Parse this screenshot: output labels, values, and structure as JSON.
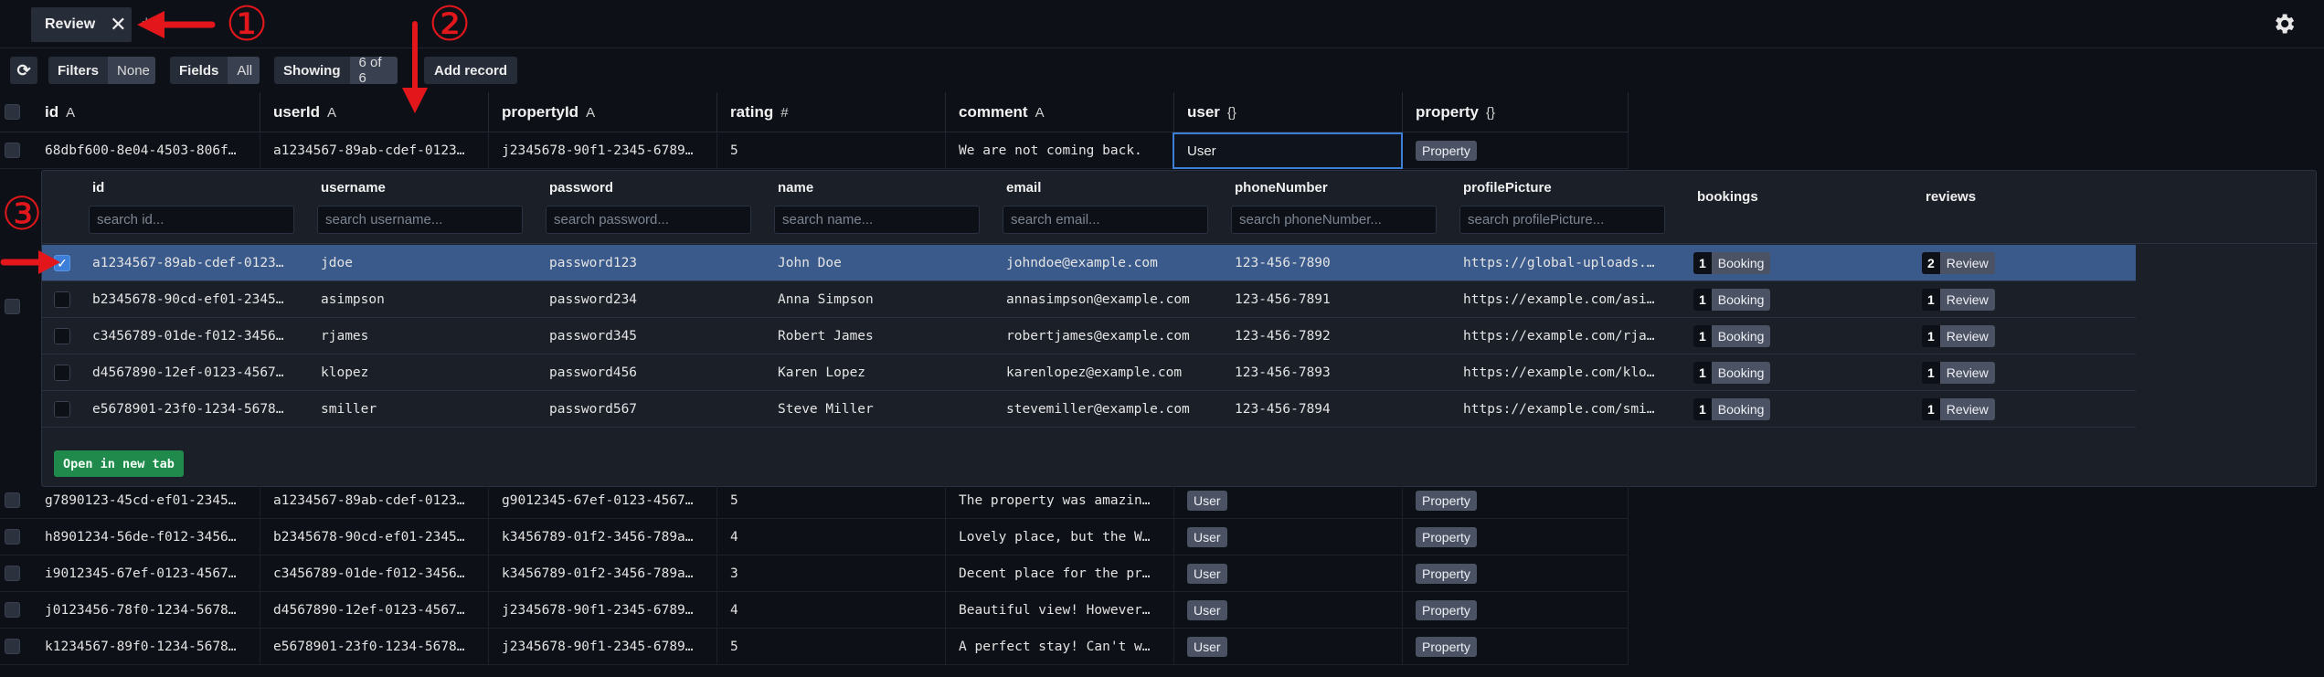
{
  "tab": {
    "label": "Review",
    "close": "✕",
    "plus": "+"
  },
  "toolbar": {
    "refresh": "⟳",
    "filters_label": "Filters",
    "filters_value": "None",
    "fields_label": "Fields",
    "fields_value": "All",
    "showing_label": "Showing",
    "showing_value": "6 of 6",
    "add_record": "Add record"
  },
  "columns": [
    {
      "name": "id",
      "type": "A"
    },
    {
      "name": "userId",
      "type": "A"
    },
    {
      "name": "propertyId",
      "type": "A"
    },
    {
      "name": "rating",
      "type": "#"
    },
    {
      "name": "comment",
      "type": "A"
    },
    {
      "name": "user",
      "type": "{}"
    },
    {
      "name": "property",
      "type": "{}"
    }
  ],
  "rows": [
    {
      "id": "68dbf600-8e04-4503-806f…",
      "userId": "a1234567-89ab-cdef-0123…",
      "propertyId": "j2345678-90f1-2345-6789…",
      "rating": "5",
      "comment": "We are not coming back.",
      "user": "User",
      "property": "Property"
    },
    {
      "id": "g7890123-45cd-ef01-2345…",
      "userId": "a1234567-89ab-cdef-0123…",
      "propertyId": "g9012345-67ef-0123-4567…",
      "rating": "5",
      "comment": "The property was amazin…",
      "user": "User",
      "property": "Property"
    },
    {
      "id": "h8901234-56de-f012-3456…",
      "userId": "b2345678-90cd-ef01-2345…",
      "propertyId": "k3456789-01f2-3456-789a…",
      "rating": "4",
      "comment": "Lovely place, but the W…",
      "user": "User",
      "property": "Property"
    },
    {
      "id": "i9012345-67ef-0123-4567…",
      "userId": "c3456789-01de-f012-3456…",
      "propertyId": "k3456789-01f2-3456-789a…",
      "rating": "3",
      "comment": "Decent place for the pr…",
      "user": "User",
      "property": "Property"
    },
    {
      "id": "j0123456-78f0-1234-5678…",
      "userId": "d4567890-12ef-0123-4567…",
      "propertyId": "j2345678-90f1-2345-6789…",
      "rating": "4",
      "comment": "Beautiful view! However…",
      "user": "User",
      "property": "Property"
    },
    {
      "id": "k1234567-89f0-1234-5678…",
      "userId": "e5678901-23f0-1234-5678…",
      "propertyId": "j2345678-90f1-2345-6789…",
      "rating": "5",
      "comment": "A perfect stay! Can't w…",
      "user": "User",
      "property": "Property"
    }
  ],
  "panel": {
    "columns": [
      {
        "name": "id",
        "placeholder": "search id..."
      },
      {
        "name": "username",
        "placeholder": "search username..."
      },
      {
        "name": "password",
        "placeholder": "search password..."
      },
      {
        "name": "name",
        "placeholder": "search name..."
      },
      {
        "name": "email",
        "placeholder": "search email..."
      },
      {
        "name": "phoneNumber",
        "placeholder": "search phoneNumber..."
      },
      {
        "name": "profilePicture",
        "placeholder": "search profilePicture..."
      },
      {
        "name": "bookings"
      },
      {
        "name": "reviews"
      }
    ],
    "rows": [
      {
        "id": "a1234567-89ab-cdef-0123…",
        "username": "jdoe",
        "password": "password123",
        "name": "John Doe",
        "email": "johndoe@example.com",
        "phone": "123-456-7890",
        "picture": "https://global-uploads.…",
        "bookings_n": "1",
        "bookings_t": "Booking",
        "reviews_n": "2",
        "reviews_t": "Review"
      },
      {
        "id": "b2345678-90cd-ef01-2345…",
        "username": "asimpson",
        "password": "password234",
        "name": "Anna Simpson",
        "email": "annasimpson@example.com",
        "phone": "123-456-7891",
        "picture": "https://example.com/asi…",
        "bookings_n": "1",
        "bookings_t": "Booking",
        "reviews_n": "1",
        "reviews_t": "Review"
      },
      {
        "id": "c3456789-01de-f012-3456…",
        "username": "rjames",
        "password": "password345",
        "name": "Robert James",
        "email": "robertjames@example.com",
        "phone": "123-456-7892",
        "picture": "https://example.com/rja…",
        "bookings_n": "1",
        "bookings_t": "Booking",
        "reviews_n": "1",
        "reviews_t": "Review"
      },
      {
        "id": "d4567890-12ef-0123-4567…",
        "username": "klopez",
        "password": "password456",
        "name": "Karen Lopez",
        "email": "karenlopez@example.com",
        "phone": "123-456-7893",
        "picture": "https://example.com/klo…",
        "bookings_n": "1",
        "bookings_t": "Booking",
        "reviews_n": "1",
        "reviews_t": "Review"
      },
      {
        "id": "e5678901-23f0-1234-5678…",
        "username": "smiller",
        "password": "password567",
        "name": "Steve Miller",
        "email": "stevemiller@example.com",
        "phone": "123-456-7894",
        "picture": "https://example.com/smi…",
        "bookings_n": "1",
        "bookings_t": "Booking",
        "reviews_n": "1",
        "reviews_t": "Review"
      }
    ],
    "open_new_tab": "Open in new tab",
    "check_glyph": "✓"
  },
  "annotations": {
    "one": "①",
    "two": "②",
    "three": "③"
  },
  "colors": {
    "accent": "#3d7ed8",
    "selected_row": "#3a5a8c",
    "annotation": "#e3161b",
    "button_green": "#1f8a4c"
  }
}
